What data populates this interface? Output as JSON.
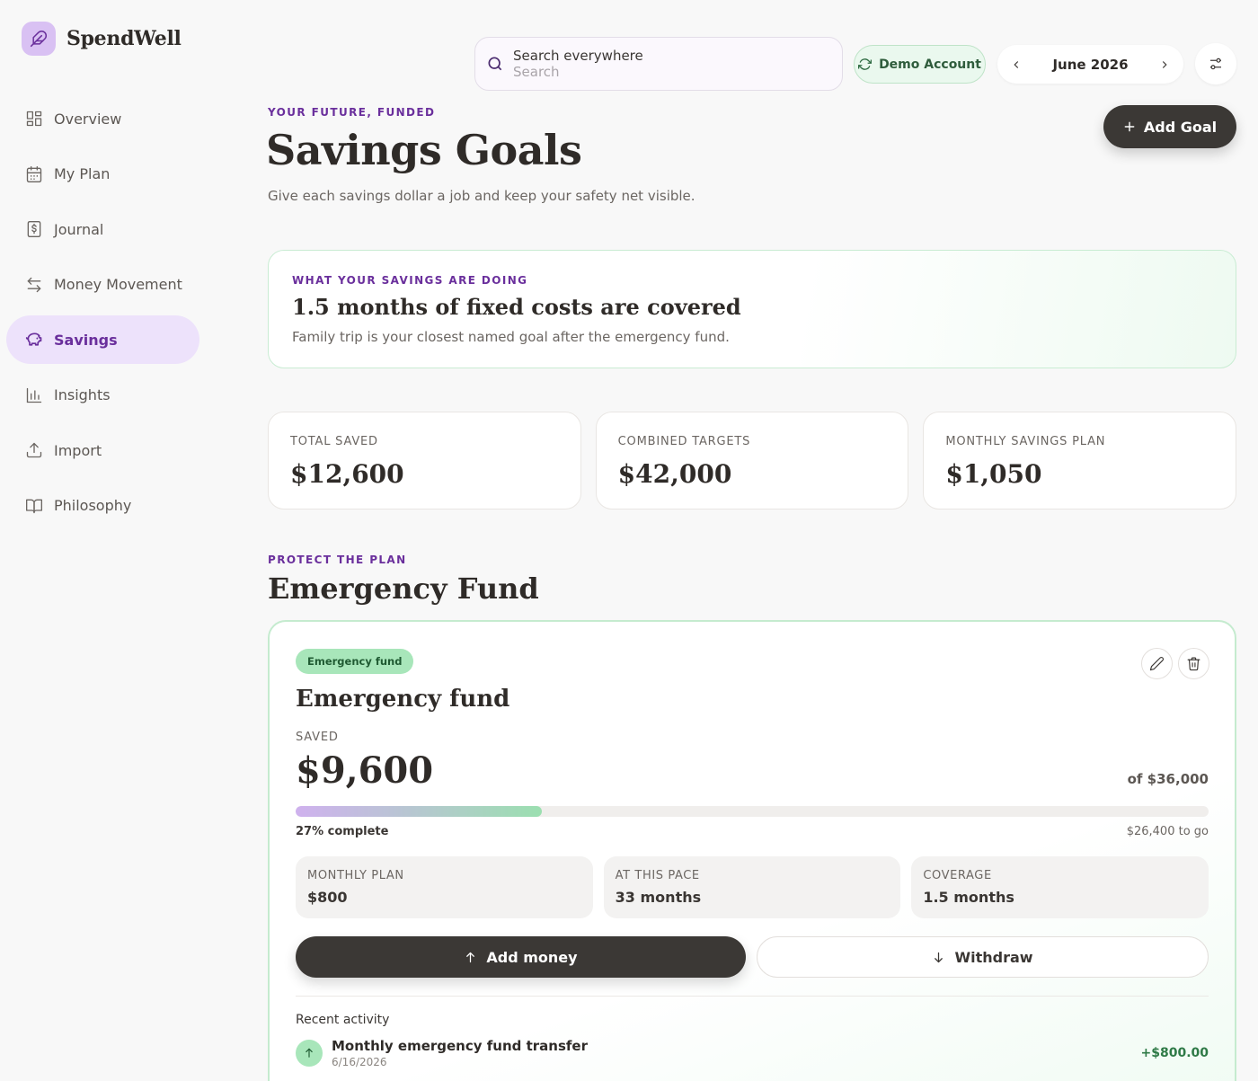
{
  "brand": {
    "name": "SpendWell",
    "logo_icon": "feather-icon",
    "logo_color": "#d9c1f3"
  },
  "sidebar": {
    "items": [
      {
        "label": "Overview",
        "icon": "dashboard-icon",
        "active": false
      },
      {
        "label": "My Plan",
        "icon": "calendar-icon",
        "active": false
      },
      {
        "label": "Journal",
        "icon": "receipt-icon",
        "active": false
      },
      {
        "label": "Money Movement",
        "icon": "arrows-left-right-icon",
        "active": false
      },
      {
        "label": "Savings",
        "icon": "piggy-bank-icon",
        "active": true
      },
      {
        "label": "Insights",
        "icon": "bar-chart-icon",
        "active": false
      },
      {
        "label": "Import",
        "icon": "upload-icon",
        "active": false
      },
      {
        "label": "Philosophy",
        "icon": "book-icon",
        "active": false
      }
    ]
  },
  "topbar": {
    "search_label": "Search everywhere",
    "search_placeholder": "Search",
    "account_label": "Demo Account",
    "month": "June 2026"
  },
  "header": {
    "eyebrow": "YOUR FUTURE, FUNDED",
    "title": "Savings Goals",
    "subtitle": "Give each savings dollar a job and keep your safety net visible.",
    "add_goal_label": "Add Goal"
  },
  "insight": {
    "eyebrow": "WHAT YOUR SAVINGS ARE DOING",
    "title": "1.5 months of fixed costs are covered",
    "desc": "Family trip is your closest named goal after the emergency fund."
  },
  "stats": [
    {
      "label": "TOTAL SAVED",
      "value": "$12,600"
    },
    {
      "label": "COMBINED TARGETS",
      "value": "$42,000"
    },
    {
      "label": "MONTHLY SAVINGS PLAN",
      "value": "$1,050"
    }
  ],
  "section": {
    "eyebrow": "PROTECT THE PLAN",
    "title": "Emergency Fund"
  },
  "goal": {
    "tag": "Emergency fund",
    "name": "Emergency fund",
    "saved_label": "SAVED",
    "saved": "$9,600",
    "target": "of $36,000",
    "progress": 0.27,
    "progress_label": "27% complete",
    "to_go": "$26,400 to go",
    "metrics": [
      {
        "label": "MONTHLY PLAN",
        "value": "$800"
      },
      {
        "label": "AT THIS PACE",
        "value": "33 months"
      },
      {
        "label": "COVERAGE",
        "value": "1.5 months"
      }
    ],
    "add_label": "Add money",
    "withdraw_label": "Withdraw",
    "activity_title": "Recent activity",
    "activity": [
      {
        "name": "Monthly emergency fund transfer",
        "date": "6/16/2026",
        "amount": "+$800.00"
      }
    ]
  },
  "colors": {
    "accent": "#6a2f9c",
    "success": "#2f7a47",
    "dark": "#3b3835"
  }
}
